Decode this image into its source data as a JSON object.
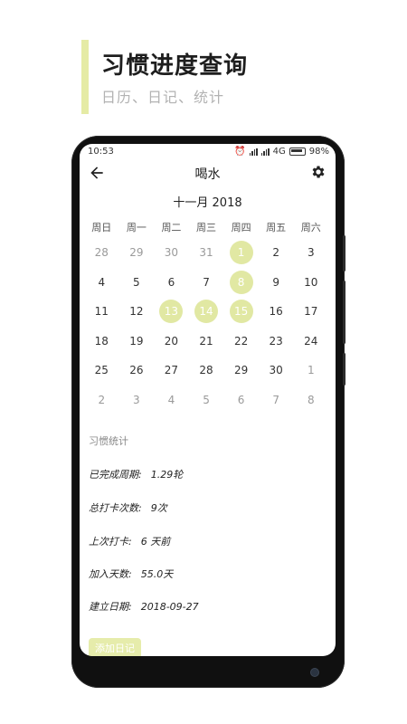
{
  "hero": {
    "title": "习惯进度查询",
    "subtitle": "日历、日记、统计"
  },
  "status": {
    "time": "10:53",
    "network": "4G",
    "battery": "98%"
  },
  "appbar": {
    "title": "喝水"
  },
  "calendar": {
    "month_label": "十一月 2018",
    "weekdays": [
      "周日",
      "周一",
      "周二",
      "周三",
      "周四",
      "周五",
      "周六"
    ],
    "weeks": [
      [
        {
          "d": "28",
          "o": true
        },
        {
          "d": "29",
          "o": true
        },
        {
          "d": "30",
          "o": true
        },
        {
          "d": "31",
          "o": true
        },
        {
          "d": "1",
          "done": true
        },
        {
          "d": "2"
        },
        {
          "d": "3"
        }
      ],
      [
        {
          "d": "4"
        },
        {
          "d": "5"
        },
        {
          "d": "6"
        },
        {
          "d": "7"
        },
        {
          "d": "8",
          "done": true
        },
        {
          "d": "9"
        },
        {
          "d": "10"
        }
      ],
      [
        {
          "d": "11"
        },
        {
          "d": "12"
        },
        {
          "d": "13",
          "done": true
        },
        {
          "d": "14",
          "done": true
        },
        {
          "d": "15",
          "done": true
        },
        {
          "d": "16"
        },
        {
          "d": "17"
        }
      ],
      [
        {
          "d": "18"
        },
        {
          "d": "19"
        },
        {
          "d": "20"
        },
        {
          "d": "21"
        },
        {
          "d": "22"
        },
        {
          "d": "23"
        },
        {
          "d": "24"
        }
      ],
      [
        {
          "d": "25"
        },
        {
          "d": "26"
        },
        {
          "d": "27"
        },
        {
          "d": "28"
        },
        {
          "d": "29"
        },
        {
          "d": "30"
        },
        {
          "d": "1",
          "o": true
        }
      ],
      [
        {
          "d": "2",
          "o": true
        },
        {
          "d": "3",
          "o": true
        },
        {
          "d": "4",
          "o": true
        },
        {
          "d": "5",
          "o": true
        },
        {
          "d": "6",
          "o": true
        },
        {
          "d": "7",
          "o": true
        },
        {
          "d": "8",
          "o": true
        }
      ]
    ]
  },
  "stats": {
    "title": "习惯统计",
    "items": [
      {
        "label": "已完成周期:",
        "value": "1.29轮"
      },
      {
        "label": "总打卡次数:",
        "value": "9次"
      },
      {
        "label": "上次打卡:",
        "value": "6 天前"
      },
      {
        "label": "加入天数:",
        "value": "55.0天"
      },
      {
        "label": "建立日期:",
        "value": "2018-09-27"
      }
    ]
  },
  "actions": {
    "add_diary": "添加日记"
  },
  "colors": {
    "accent": "#e1e8a3",
    "hero_bar": "#e5eba5"
  }
}
